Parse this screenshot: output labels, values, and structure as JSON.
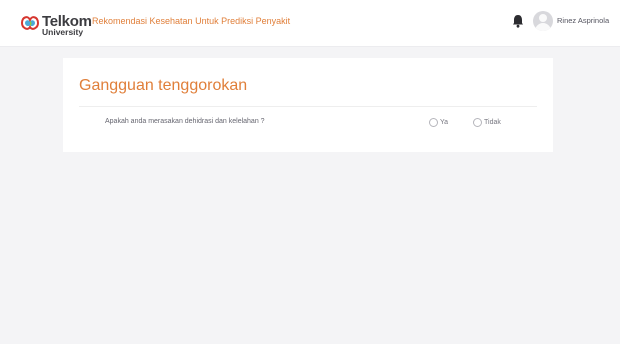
{
  "header": {
    "logo_text": "Telkom",
    "logo_subtext": "University",
    "app_title": "Rekomendasi Kesehatan Untuk Prediksi Penyakit",
    "user_name": "Rinez Asprinola",
    "bell_icon": "bell-icon",
    "avatar_icon": "user-avatar-icon"
  },
  "card": {
    "title": "Gangguan tenggorokan",
    "question": "Apakah anda merasakan dehidrasi dan kelelahan ?",
    "options": [
      "Ya",
      "Tidak"
    ]
  },
  "colors": {
    "accent": "#e07f3a",
    "background": "#f4f4f6",
    "card": "#ffffff"
  }
}
